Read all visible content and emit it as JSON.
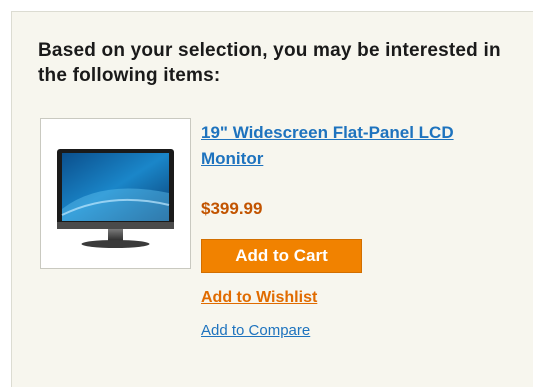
{
  "recommendations": {
    "heading": "Based on your selection, you may be interested in the following items:",
    "item": {
      "image_icon": "monitor-product-image",
      "name": "19\" Widescreen Flat-Panel LCD Monitor",
      "price": "$399.99",
      "add_to_cart_label": "Add to Cart",
      "add_to_wishlist_label": "Add to Wishlist",
      "add_to_compare_label": "Add to Compare"
    }
  },
  "colors": {
    "panel_background": "#f7f6ee",
    "link_blue": "#1e73be",
    "price_orange": "#c25400",
    "button_orange": "#f18200",
    "wishlist_orange": "#e06b00"
  }
}
